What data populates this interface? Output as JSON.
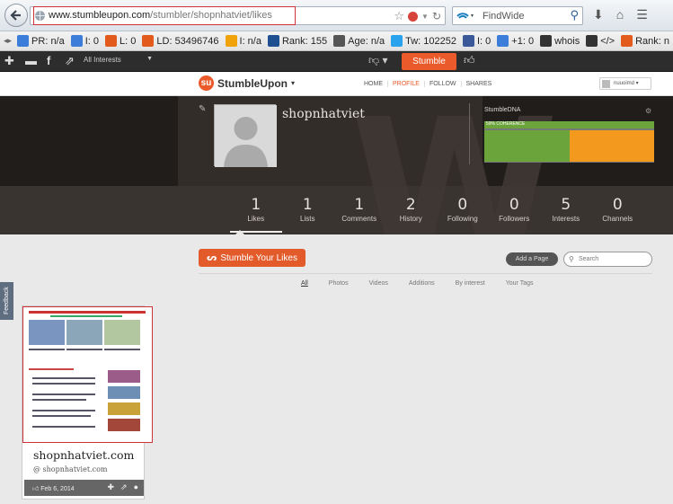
{
  "browser": {
    "url_host": "www.stumbleupon.com",
    "url_path": "/stumbler/shopnhatviet/likes",
    "search_placeholder": "FindWide"
  },
  "seo_toolbar": [
    {
      "label": "PR: n/a",
      "icon": "google-icon",
      "color": "#3b7dd8"
    },
    {
      "label": "I: 0",
      "icon": "google-icon",
      "color": "#3b7dd8"
    },
    {
      "label": "L: 0",
      "icon": "yahoo-icon",
      "color": "#e35a1d"
    },
    {
      "label": "LD: 53496746",
      "icon": "yahoo-icon",
      "color": "#e35a1d"
    },
    {
      "label": "I: n/a",
      "icon": "bing-icon",
      "color": "#f0a30a"
    },
    {
      "label": "Rank: 155",
      "icon": "alexa-icon",
      "color": "#1d4f91"
    },
    {
      "label": "Age: n/a",
      "icon": "archive-icon",
      "color": "#555555"
    },
    {
      "label": "Tw: 102252",
      "icon": "twitter-icon",
      "color": "#2aa3ef"
    },
    {
      "label": "I: 0",
      "icon": "facebook-icon",
      "color": "#3b5998"
    },
    {
      "label": "+1: 0",
      "icon": "google-plus-icon",
      "color": "#3b7dd8"
    },
    {
      "label": "whois",
      "icon": "whois-icon",
      "color": "#333333"
    },
    {
      "label": "</>",
      "icon": "source-icon",
      "color": "#333333"
    },
    {
      "label": "Rank: n",
      "icon": "rank-icon",
      "color": "#e35a1d"
    }
  ],
  "su_toolbar": {
    "interests_select": "All Interests",
    "stumble_label": "Stumble"
  },
  "su_header": {
    "logo": "StumbleUpon",
    "nav": [
      "HOME",
      "PROFILE",
      "FOLLOW",
      "SHARES"
    ],
    "active_nav": "PROFILE",
    "user_menu": "nuuoimd"
  },
  "profile": {
    "name": "shopnhatviet",
    "dna_label": "StumbleDNA",
    "dna_top": "59% COHERENCE",
    "stats": [
      {
        "num": "1",
        "label": "Likes"
      },
      {
        "num": "1",
        "label": "Lists"
      },
      {
        "num": "1",
        "label": "Comments"
      },
      {
        "num": "2",
        "label": "History"
      },
      {
        "num": "0",
        "label": "Following"
      },
      {
        "num": "0",
        "label": "Followers"
      },
      {
        "num": "5",
        "label": "Interests"
      },
      {
        "num": "0",
        "label": "Channels"
      }
    ]
  },
  "likes": {
    "stumble_likes_label": "Stumble Your Likes",
    "add_page_label": "Add a Page",
    "search_placeholder": "Search",
    "filters": [
      "All",
      "Photos",
      "Videos",
      "Additions",
      "By interest",
      "Your Tags"
    ],
    "active_filter": "All",
    "feedback_label": "Feedback"
  },
  "card": {
    "title": "shopnhatviet.com",
    "domain": "shopnhatviet.com",
    "date": "Feb 6, 2014"
  }
}
